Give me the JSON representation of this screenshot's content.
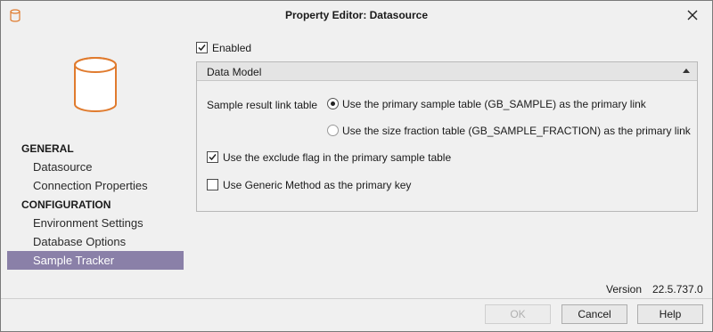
{
  "window": {
    "title": "Property Editor:  Datasource",
    "icon": "database-icon",
    "close_icon": "close-icon"
  },
  "sidebar": {
    "logo_icon": "database-cylinder-icon",
    "accent_color": "#e07b2e",
    "selected_color": "#8a80a8",
    "sections": [
      {
        "header": "GENERAL",
        "items": [
          "Datasource",
          "Connection Properties"
        ]
      },
      {
        "header": "CONFIGURATION",
        "items": [
          "Environment Settings",
          "Database Options",
          "Sample Tracker"
        ]
      }
    ],
    "selected_item": "Sample Tracker"
  },
  "main": {
    "enabled": {
      "label": "Enabled",
      "checked": true
    },
    "group": {
      "title": "Data Model",
      "expanded": true,
      "link_table": {
        "label": "Sample result link table",
        "options": [
          {
            "label": "Use the primary sample table (GB_SAMPLE) as the primary link",
            "selected": true
          },
          {
            "label": "Use the size fraction table (GB_SAMPLE_FRACTION) as the primary link",
            "selected": false
          }
        ]
      },
      "exclude_flag": {
        "label": "Use the exclude flag in the primary sample table",
        "checked": true
      },
      "generic_method": {
        "label": "Use Generic Method as the primary key",
        "checked": false
      }
    }
  },
  "footer": {
    "version_label": "Version",
    "version_value": "22.5.737.0",
    "buttons": {
      "ok": {
        "label": "OK",
        "enabled": false
      },
      "cancel": {
        "label": "Cancel",
        "enabled": true
      },
      "help": {
        "label": "Help",
        "enabled": true
      }
    }
  }
}
